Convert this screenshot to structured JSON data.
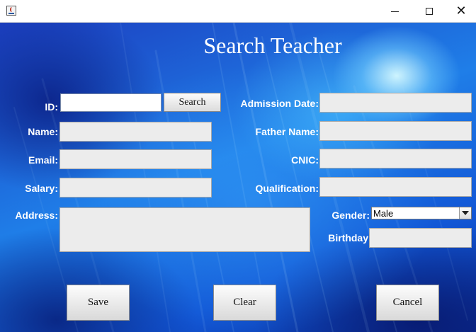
{
  "window": {
    "close_glyph": "✕"
  },
  "page": {
    "title": "Search Teacher"
  },
  "form": {
    "id_label": "ID:",
    "id_value": "",
    "search_label": "Search",
    "name_label": "Name:",
    "email_label": "Email:",
    "salary_label": "Salary:",
    "address_label": "Address:",
    "admission_date_label": "Admission Date:",
    "father_name_label": "Father Name:",
    "cnic_label": "CNIC:",
    "qualification_label": "Qualification:",
    "gender_label": "Gender:",
    "gender_value": "Male",
    "birthday_label": "Birthday"
  },
  "actions": {
    "save_label": "Save",
    "clear_label": "Clear",
    "cancel_label": "Cancel"
  },
  "icons": [
    "java-app-icon",
    "minimize-icon",
    "maximize-icon",
    "close-icon",
    "chevron-down-icon"
  ],
  "colors": {
    "background_accent": "#1f7ee8",
    "field_bg": "#ececec",
    "label_text": "#ffffff"
  }
}
